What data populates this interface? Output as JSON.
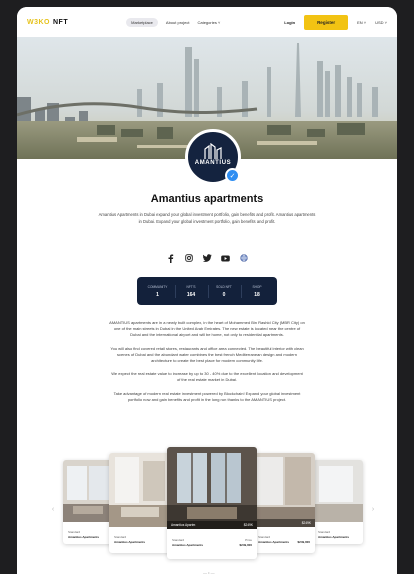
{
  "header": {
    "logo_mark": "W3KO",
    "logo_suffix": "NFT",
    "nav": [
      "Marketplace",
      "About project",
      "Categories ˅"
    ],
    "login": "Login",
    "register": "Register",
    "lang": "EN ˅",
    "currency": "USD ˅"
  },
  "avatar_label": "AMANTIUS",
  "title": "Amantius apartments",
  "description": "Amantius Apartments in Dubai expand your global investment portfolio, gain benefits and profit. Amantius apartments in Dubai. Expand your global investment portfolio, gain benefits and profit.",
  "stats": [
    {
      "label": "COMMUNITY",
      "value": "1"
    },
    {
      "label": "NFT'S",
      "value": "164"
    },
    {
      "label": "SOLD NFT",
      "value": "0"
    },
    {
      "label": "SHOP",
      "value": "18"
    }
  ],
  "body": [
    "AMANTIUS apartments are in a newly built complex, in the heart of Mohammed Bin Rashid City (MBR City) on one of the main streets in Dubai in the United Arab Emirates. The new estate is located near the centre of Dubai and the international airport and will be home, not only to residential apartments.",
    "You will also find covered retail stores, restaurants and office area connected. The beautiful interior with clean scenes of Dubai and the abundant water combines the best french Mediterranean design and modern architecture to create the best place for modern community life.",
    "We expect the real estate value to increase by up to 30 - 40% due to the excellent location and development of the real estate market in Dubai.",
    "Take advantage of modern real estate investment powered by Blockchain! Expand your global investment portfolio now and gain benefits and profit in the long run thanks to the AMANTIUS project."
  ],
  "cards": [
    {
      "name": "Amantius Apartments",
      "price": "$249,000"
    },
    {
      "name": "Amantius Apartments",
      "price": "$249,000"
    },
    {
      "name": "Amantius Apartments",
      "price": "$249,000",
      "label": "Amantius Apartm",
      "label_price": "$249K"
    },
    {
      "name": "Amantius Apartments",
      "price": "$249,000",
      "label_price": "$249K"
    },
    {
      "name": "Amantius Apartments",
      "price": "$249,000"
    }
  ],
  "card_caption": "Standard",
  "card_meta": "Price",
  "pager": "— • —"
}
